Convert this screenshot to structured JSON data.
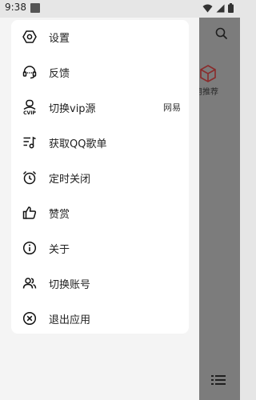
{
  "status_bar": {
    "time": "9:38"
  },
  "background": {
    "category_label": "用推荐"
  },
  "menu": {
    "items": [
      {
        "id": "settings",
        "icon": "settings-icon",
        "label": "设置"
      },
      {
        "id": "feedback",
        "icon": "headset-icon",
        "label": "反馈"
      },
      {
        "id": "vip",
        "icon": "vip-user-icon",
        "label": "切换vip源",
        "value": "网易"
      },
      {
        "id": "qq",
        "icon": "music-list-icon",
        "label": "获取QQ歌单"
      },
      {
        "id": "timer",
        "icon": "alarm-clock-icon",
        "label": "定时关闭"
      },
      {
        "id": "like",
        "icon": "thumbs-up-icon",
        "label": "赞赏"
      },
      {
        "id": "about",
        "icon": "info-icon",
        "label": "关于"
      },
      {
        "id": "account",
        "icon": "users-icon",
        "label": "切换账号"
      },
      {
        "id": "exit",
        "icon": "close-circle-icon",
        "label": "退出应用"
      }
    ]
  }
}
